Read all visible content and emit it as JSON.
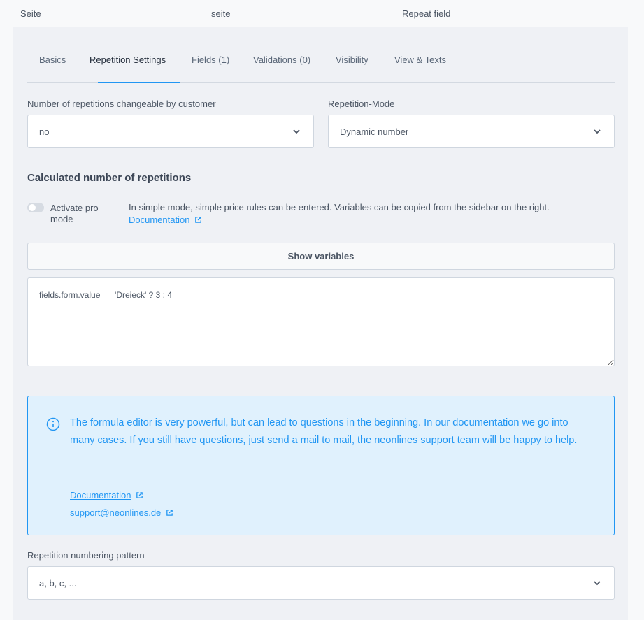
{
  "top_row": {
    "col1": "Seite",
    "col2": "seite",
    "col3": "Repeat field"
  },
  "tabs": [
    {
      "label": "Basics",
      "active": false
    },
    {
      "label": "Repetition Settings",
      "active": true
    },
    {
      "label": "Fields (1)",
      "active": false
    },
    {
      "label": "Validations (0)",
      "active": false
    },
    {
      "label": "Visibility",
      "active": false
    },
    {
      "label": "View & Texts",
      "active": false
    }
  ],
  "fields": {
    "changeable": {
      "label": "Number of repetitions changeable by customer",
      "value": "no"
    },
    "mode": {
      "label": "Repetition-Mode",
      "value": "Dynamic number"
    },
    "numbering": {
      "label": "Repetition numbering pattern",
      "value": "a, b, c, ..."
    }
  },
  "calculated": {
    "title": "Calculated number of repetitions",
    "toggle_label": "Activate pro mode",
    "toggle_on": false,
    "hint": "In simple mode, simple price rules can be entered. Variables can be copied from the sidebar on the right.",
    "doc_link": "Documentation",
    "show_variables": "Show variables",
    "formula": "fields.form.value == 'Dreieck' ? 3 : 4"
  },
  "info": {
    "text": "The formula editor is very powerful, but can lead to questions in the beginning. In our documentation we go into many cases. If you still have questions, just send a mail to mail, the neonlines support team will be happy to help.",
    "doc_link": "Documentation",
    "support_link": "support@neonlines.de"
  },
  "colors": {
    "accent": "#2196f3",
    "panel": "#eff1f5",
    "info_bg": "#e0f1fd"
  }
}
